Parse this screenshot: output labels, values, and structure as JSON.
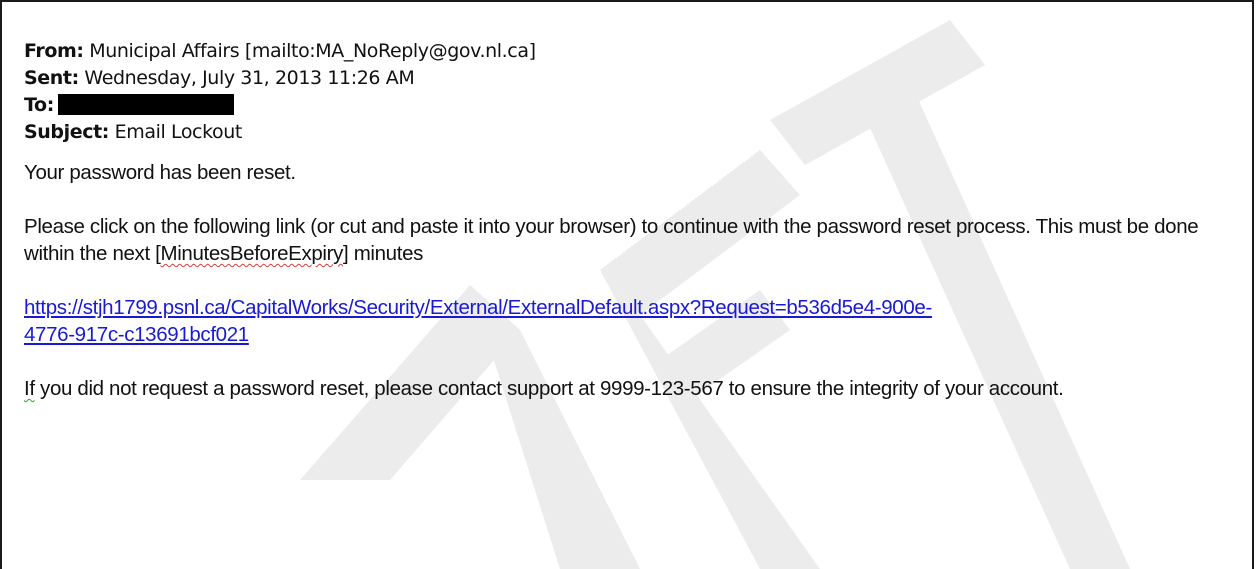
{
  "email": {
    "headers": {
      "from_label": "From:",
      "from_value": " Municipal Affairs [mailto:MA_NoReply@gov.nl.ca]",
      "sent_label": "Sent:",
      "sent_value": " Wednesday, July 31, 2013 11:26 AM",
      "to_label": "To:",
      "subject_label": "Subject:",
      "subject_value": " Email Lockout"
    },
    "body": {
      "p1": "Your password has been reset.",
      "p2_before": "Please click on the following link (or cut and paste it into your browser) to continue with the password reset process. This must be done within the next [",
      "p2_placeholder": "MinutesBeforeExpiry",
      "p2_after": "] minutes",
      "link_line1": "https://stjh1799.psnl.ca/CapitalWorks/Security/External/ExternalDefault.aspx?Request=b536d5e4-900e-",
      "link_line2": "4776-917c-c13691bcf021",
      "p4_first": "If",
      "p4_rest": " you did not request a password reset, please contact support at 9999-123-567 to ensure the integrity of your account."
    }
  },
  "colors": {
    "link": "#1a1ad0",
    "watermark": "#ececec",
    "redaction": "#000000"
  }
}
